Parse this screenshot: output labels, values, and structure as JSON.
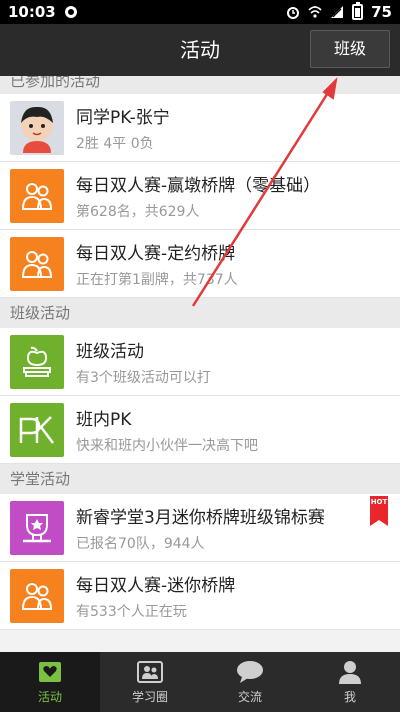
{
  "status_bar": {
    "time": "10:03",
    "battery": "75"
  },
  "app_bar": {
    "title": "活动",
    "class_button": "班级"
  },
  "sections": [
    {
      "header": "已参加的活动",
      "items": [
        {
          "title": "同学PK-张宁",
          "subtitle": "2胜 4平 0负",
          "icon": "avatar-icon"
        },
        {
          "title": "每日双人赛-赢墩桥牌（零基础）",
          "subtitle": "第628名，共629人",
          "icon": "people-icon"
        },
        {
          "title": "每日双人赛-定约桥牌",
          "subtitle": "正在打第1副牌，共737人",
          "icon": "people-icon"
        }
      ]
    },
    {
      "header": "班级活动",
      "items": [
        {
          "title": "班级活动",
          "subtitle": "有3个班级活动可以打",
          "icon": "apple-book-icon"
        },
        {
          "title": "班内PK",
          "subtitle": "快来和班内小伙伴一决高下吧",
          "icon": "pk-icon"
        }
      ]
    },
    {
      "header": "学堂活动",
      "items": [
        {
          "title": "新睿学堂3月迷你桥牌班级锦标赛",
          "subtitle": "已报名70队，944人",
          "icon": "trophy-icon",
          "badge": "HOT"
        },
        {
          "title": "每日双人赛-迷你桥牌",
          "subtitle": "有533个人正在玩",
          "icon": "people-icon"
        }
      ]
    }
  ],
  "tabs": [
    {
      "label": "活动",
      "active": true
    },
    {
      "label": "学习圈"
    },
    {
      "label": "交流"
    },
    {
      "label": "我"
    }
  ],
  "colors": {
    "orange": "#f5821f",
    "green": "#6fb12d",
    "purple": "#c24cc6",
    "active_tab": "#7ac143",
    "arrow": "#e23a3a"
  }
}
